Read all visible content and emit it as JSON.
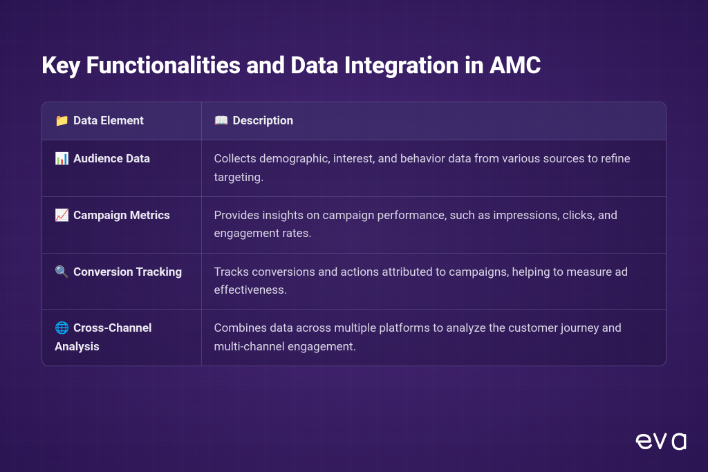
{
  "title": "Key Functionalities and Data Integration in AMC",
  "headers": {
    "element_icon": "📁",
    "element_label": "Data Element",
    "description_icon": "📖",
    "description_label": "Description"
  },
  "rows": [
    {
      "icon": "📊",
      "name": "Audience Data",
      "description": "Collects demographic, interest, and behavior data from various sources to refine targeting."
    },
    {
      "icon": "📈",
      "name": "Campaign Metrics",
      "description": "Provides insights on campaign performance, such as impressions, clicks, and engagement rates."
    },
    {
      "icon": "🔍",
      "name": "Conversion Tracking",
      "description": "Tracks conversions and actions attributed to campaigns, helping to measure ad effectiveness."
    },
    {
      "icon": "🌐",
      "name": "Cross-Channel Analysis",
      "description": "Combines data across multiple platforms to analyze the customer journey and multi-channel engagement."
    }
  ],
  "brand": "eva"
}
